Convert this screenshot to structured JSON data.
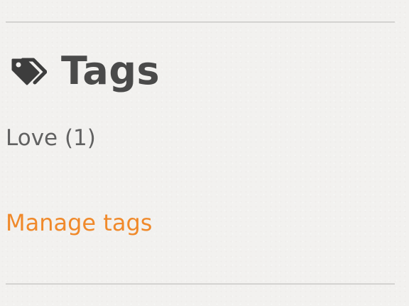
{
  "widget": {
    "title": "Tags",
    "icon": "tags-icon",
    "text_color": "#4a4a4a"
  },
  "tags": [
    {
      "label": "Love (1)"
    }
  ],
  "manage_link": {
    "label": "Manage tags",
    "color": "#f0892a"
  }
}
